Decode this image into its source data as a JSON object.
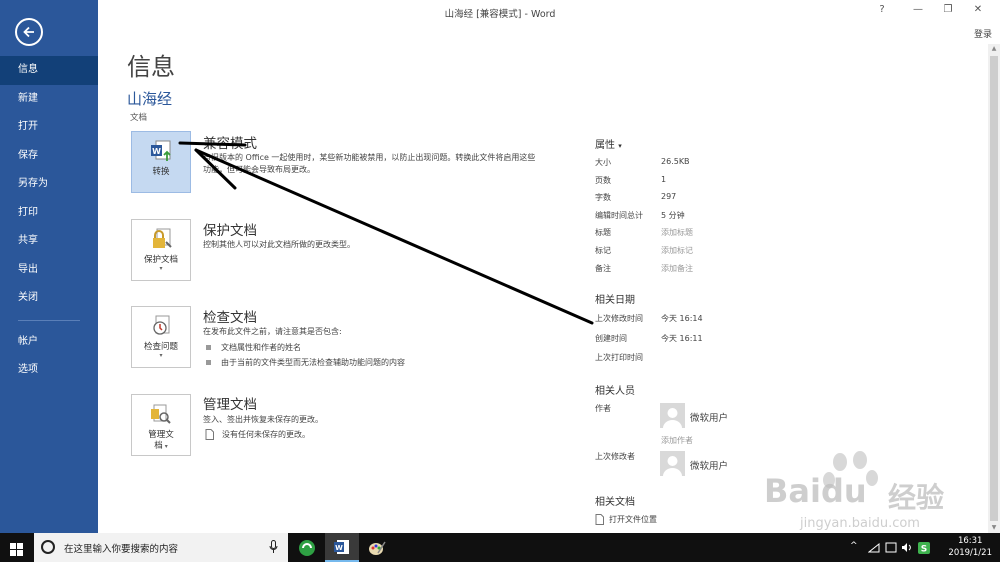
{
  "window": {
    "title": "山海经 [兼容模式] - Word",
    "help": "?",
    "minimize": "—",
    "restore": "❐",
    "close": "✕",
    "login": "登录"
  },
  "sidebar": {
    "items": [
      {
        "label": "信息",
        "active": true
      },
      {
        "label": "新建"
      },
      {
        "label": "打开"
      },
      {
        "label": "保存"
      },
      {
        "label": "另存为"
      },
      {
        "label": "打印"
      },
      {
        "label": "共享"
      },
      {
        "label": "导出"
      },
      {
        "label": "关闭"
      }
    ],
    "bottom_items": [
      {
        "label": "帐户"
      },
      {
        "label": "选项"
      }
    ]
  },
  "main": {
    "page_title": "信息",
    "doc_name": "山海经",
    "doc_type": "文档",
    "sections": [
      {
        "button_label": "转换",
        "title": "兼容模式",
        "desc": "与旧版本的 Office 一起使用时，某些新功能被禁用，以防止出现问题。转换此文件将启用这些功能，但可能会导致布局更改。"
      },
      {
        "button_label": "保护文档",
        "title": "保护文档",
        "desc": "控制其他人可以对此文档所做的更改类型。"
      },
      {
        "button_label": "检查问题",
        "title": "检查文档",
        "desc": "在发布此文件之前，请注意其是否包含:",
        "bullets": [
          "文档属性和作者的姓名",
          "由于当前的文件类型而无法检查辅助功能问题的内容"
        ]
      },
      {
        "button_label_1": "管理文",
        "button_label_2": "档",
        "title": "管理文档",
        "desc": "签入、签出并恢复未保存的更改。",
        "note": "没有任何未保存的更改。"
      }
    ]
  },
  "properties": {
    "header": "属性",
    "caret": "▾",
    "rows": [
      {
        "label": "大小",
        "value": "26.5KB"
      },
      {
        "label": "页数",
        "value": "1"
      },
      {
        "label": "字数",
        "value": "297"
      },
      {
        "label": "编辑时间总计",
        "value": "5 分钟"
      },
      {
        "label": "标题",
        "value": "添加标题"
      },
      {
        "label": "标记",
        "value": "添加标记"
      },
      {
        "label": "备注",
        "value": "添加备注"
      }
    ],
    "dates_header": "相关日期",
    "dates": [
      {
        "label": "上次修改时间",
        "value": "今天 16:14"
      },
      {
        "label": "创建时间",
        "value": "今天 16:11"
      },
      {
        "label": "上次打印时间",
        "value": ""
      }
    ],
    "people_header": "相关人员",
    "author_label": "作者",
    "author_name": "微软用户",
    "add_author": "添加作者",
    "last_modified_by_label": "上次修改者",
    "last_modified_by_name": "微软用户",
    "related_docs_header": "相关文档",
    "open_file_location": "打开文件位置"
  },
  "taskbar": {
    "search_placeholder": "在这里输入你要搜索的内容",
    "time": "16:31",
    "date": "2019/1/21",
    "tray_up": "^"
  },
  "watermark": {
    "brand": "Baidu",
    "brand_cn": "经验",
    "url": "jingyan.baidu.com"
  },
  "colors": {
    "sidebar": "#2b579a",
    "sidebar_active": "#124078",
    "accent": "#2b579a",
    "taskbar": "#101010"
  }
}
